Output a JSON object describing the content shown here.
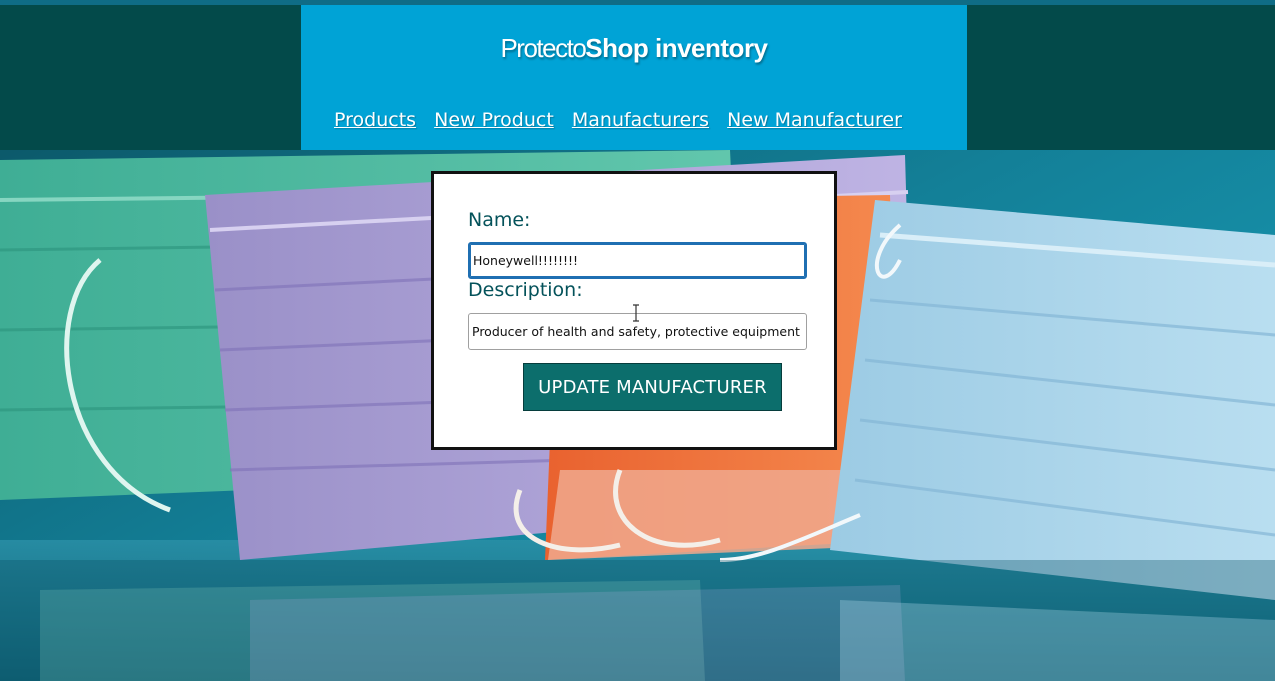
{
  "brand": {
    "light": "Protecto",
    "bold": "Shop inventory"
  },
  "nav": {
    "items": [
      {
        "label": "Products"
      },
      {
        "label": "New Product"
      },
      {
        "label": "Manufacturers"
      },
      {
        "label": "New Manufacturer"
      }
    ]
  },
  "form": {
    "name_label": "Name:",
    "name_value": "Honeywell!!!!!!!!",
    "description_label": "Description:",
    "description_value": "Producer of health and safety, protective equipment",
    "submit_label": "UPDATE MANUFACTURER"
  },
  "colors": {
    "header_bg": "#00a3d6",
    "band_bg": "#034a4a",
    "button_bg": "#0c6e6c",
    "label_color": "#04525a"
  },
  "icons": {
    "cursor": "text-cursor-icon"
  }
}
